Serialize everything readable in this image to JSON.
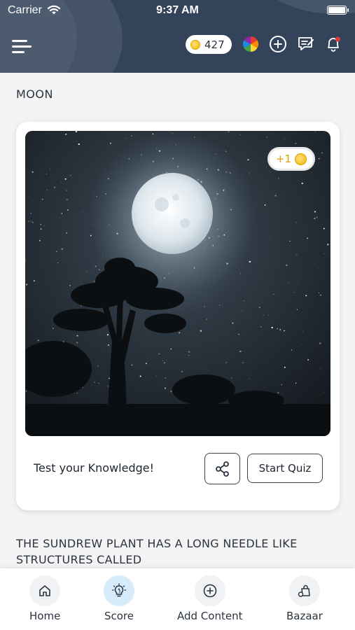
{
  "status_bar": {
    "carrier": "Carrier",
    "time": "9:37 AM"
  },
  "header": {
    "coins": "427",
    "icons": [
      "menu-icon",
      "coin-icon",
      "color-wheel-icon",
      "add-circle-icon",
      "notes-icon",
      "bell-icon"
    ]
  },
  "section": {
    "title": "MOON"
  },
  "card": {
    "badge": "+1",
    "prompt": "Test your Knowledge!",
    "start_quiz_label": "Start Quiz"
  },
  "next_item": {
    "question": "THE SUNDREW PLANT HAS A LONG NEEDLE LIKE STRUCTURES CALLED"
  },
  "bottom_nav": {
    "items": [
      {
        "label": "Home",
        "icon": "home-icon"
      },
      {
        "label": "Score",
        "icon": "lightbulb-icon",
        "active": true
      },
      {
        "label": "Add Content",
        "icon": "add-circle-icon"
      },
      {
        "label": "Bazaar",
        "icon": "bag-icon"
      }
    ]
  },
  "colors": {
    "header_bg": "#32435a",
    "accent": "#e1a100",
    "active_nav": "#d6ecfb"
  }
}
